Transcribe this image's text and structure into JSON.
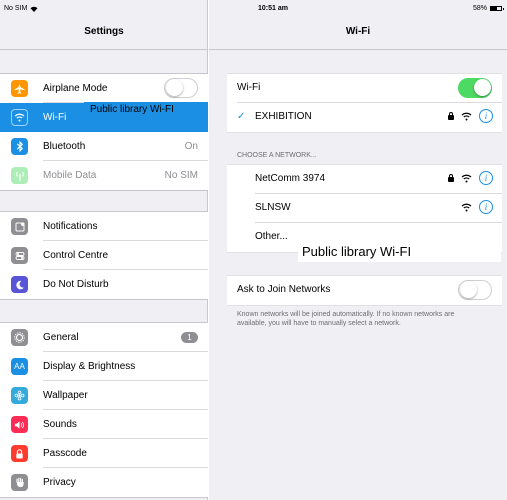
{
  "status": {
    "carrier": "No SIM",
    "time": "10:51 am",
    "battery": "58%"
  },
  "left": {
    "title": "Settings",
    "group1": [
      {
        "label": "Airplane Mode",
        "icon": "airplane-icon",
        "color": "#ff9500",
        "toggle": "off"
      },
      {
        "label": "Wi-Fi",
        "icon": "wifi-icon",
        "color": "#1a8fe3",
        "selected": true
      },
      {
        "label": "Bluetooth",
        "icon": "bluetooth-icon",
        "color": "#1a8fe3",
        "value": "On"
      },
      {
        "label": "Mobile Data",
        "icon": "antenna-icon",
        "color": "#4cd964",
        "value": "No SIM",
        "dim": true
      }
    ],
    "group2": [
      {
        "label": "Notifications",
        "icon": "notifications-icon",
        "color": "#8e8e93"
      },
      {
        "label": "Control Centre",
        "icon": "control-centre-icon",
        "color": "#8e8e93"
      },
      {
        "label": "Do Not Disturb",
        "icon": "moon-icon",
        "color": "#5856d6"
      }
    ],
    "group3": [
      {
        "label": "General",
        "icon": "gear-icon",
        "color": "#8e8e93",
        "badge": "1"
      },
      {
        "label": "Display & Brightness",
        "icon": "display-icon",
        "color": "#1a8fe3"
      },
      {
        "label": "Wallpaper",
        "icon": "wallpaper-icon",
        "color": "#34aadc"
      },
      {
        "label": "Sounds",
        "icon": "speaker-icon",
        "color": "#ff2d55"
      },
      {
        "label": "Passcode",
        "icon": "lock-icon",
        "color": "#ff3b30"
      },
      {
        "label": "Privacy",
        "icon": "hand-icon",
        "color": "#8e8e93"
      }
    ]
  },
  "overlay": {
    "text1": "Public library Wi-FI",
    "text2": "Public library Wi-FI"
  },
  "right": {
    "title": "Wi-Fi",
    "wifi_label": "Wi-Fi",
    "wifi_toggle": "on",
    "connected": {
      "check": "✓",
      "name": "EXHIBITION"
    },
    "choose_header": "CHOOSE A NETWORK...",
    "networks": [
      {
        "name": "NetComm 3974",
        "locked": true
      },
      {
        "name": "SLNSW",
        "locked": false
      },
      {
        "name": "Other..."
      }
    ],
    "ask_label": "Ask to Join Networks",
    "ask_toggle": "off",
    "ask_note": "Known networks will be joined automatically. If no known networks are available, you will have to manually select a network."
  }
}
